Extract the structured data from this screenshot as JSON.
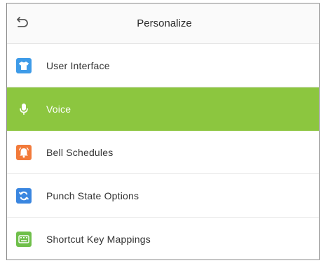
{
  "header": {
    "title": "Personalize",
    "back_icon": "back-arrow-icon"
  },
  "menu": {
    "items": [
      {
        "label": "User Interface",
        "icon": "shirt-icon",
        "icon_color": "#3e9be8",
        "active": false
      },
      {
        "label": "Voice",
        "icon": "microphone-icon",
        "icon_color": "#ffffff",
        "active": true
      },
      {
        "label": "Bell Schedules",
        "icon": "bell-icon",
        "icon_color": "#f27a3a",
        "active": false
      },
      {
        "label": "Punch State Options",
        "icon": "refresh-icon",
        "icon_color": "#3a86e0",
        "active": false
      },
      {
        "label": "Shortcut Key Mappings",
        "icon": "keyboard-icon",
        "icon_color": "#6fbf4a",
        "active": false
      }
    ]
  },
  "colors": {
    "active_background": "#8cc63f",
    "text": "#333333",
    "divider": "#e4e4e4"
  }
}
